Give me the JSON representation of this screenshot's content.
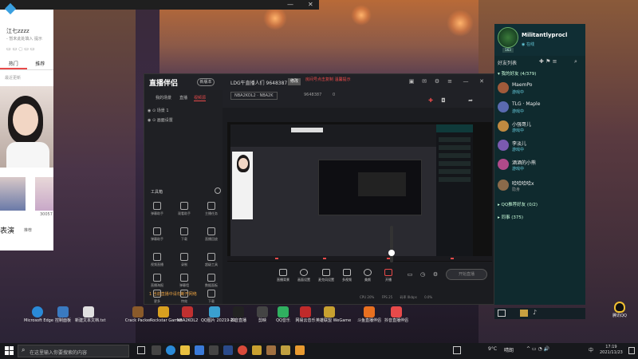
{
  "top_left_window": {
    "user": "江七zzzz",
    "subtitle": "- 暂未此处填入 提示",
    "tabs": [
      "热门",
      "推荐"
    ],
    "list_label": "最近更新",
    "side_text_1": "表演",
    "side_text_2": "推荐",
    "side_count": "30057"
  },
  "main_window": {
    "logo": "直播伴侣",
    "version": "新版本",
    "room_title": "LDG午直播人们 9648387",
    "edit": "修改",
    "warning": "房间号点击复制 温馨提示",
    "game_tag": "NBA2KOL2 · NBA2K",
    "room_id": "9648387",
    "fans": "0",
    "left_tabs": [
      "我的场景",
      "直播",
      "视频源"
    ],
    "scenes": [
      "场景 1",
      "画面设置"
    ],
    "tools_label": "工具箱",
    "tools": [
      "弹幕助手",
      "观看助手",
      "主播任务",
      "弹幕助手",
      "下载",
      "直播回放",
      "视频直播",
      "录制",
      "超级工具",
      "直播海报",
      "弹幕墙",
      "数据面板",
      "更多",
      "特效",
      "下载"
    ],
    "status_line": "1 当前直播中请勿断开网络",
    "bottom_buttons": [
      "直播背景",
      "画面设置",
      "麦克风设置",
      "多视频",
      "美颜",
      "开播"
    ],
    "live_button": "开始直播",
    "footer_stats": [
      "CPU 20%",
      "FPS 25",
      "码率 0kbps",
      "0.0%"
    ]
  },
  "qq_panel": {
    "nickname": "Militantlyprocl",
    "status": "在线",
    "level": "163",
    "friends_heading": "好友列表",
    "groups": [
      "我的好友 (4/379)",
      "QQ推荐好友 (0/2)",
      "同事 (375)"
    ],
    "contacts": [
      {
        "name": "MaemPo",
        "status": "游戏中",
        "color": "#a05a3a"
      },
      {
        "name": "TLG · Maple",
        "status": "游戏中",
        "color": "#5a6ab0"
      },
      {
        "name": "小强哥儿",
        "status": "游戏中",
        "color": "#c08a40"
      },
      {
        "name": "李淡儿",
        "status": "游戏中",
        "color": "#7a5ab0"
      },
      {
        "name": "酒酒的小熊",
        "status": "游戏中",
        "color": "#b04a8a"
      },
      {
        "name": "哈哈哈哈x",
        "status": "隐身",
        "color": "#8a6a4a"
      }
    ]
  },
  "desktop_icons": [
    {
      "label": "Microsoft Edge",
      "color": "#2a8ad8"
    },
    {
      "label": "控制面板",
      "color": "#3a7ac0"
    },
    {
      "label": "新建文本文档.txt",
      "color": "#e0e0e0"
    },
    {
      "label": "Crack Packer",
      "color": "#8a5a2a"
    },
    {
      "label": "Rockstar Games",
      "color": "#d8a020"
    },
    {
      "label": "NBA2KOL2",
      "color": "#c03030"
    },
    {
      "label": "QQ图片 20219-21",
      "color": "#3aa0d0"
    },
    {
      "label": "抖音直播",
      "color": "#222"
    },
    {
      "label": "剪映",
      "color": "#444"
    },
    {
      "label": "QQ音乐",
      "color": "#30b060"
    },
    {
      "label": "网易云音乐",
      "color": "#c02a2a"
    },
    {
      "label": "英雄联盟 WeGame",
      "color": "#c8a030"
    },
    {
      "label": "斗鱼直播伴侣",
      "color": "#e87020"
    },
    {
      "label": "抖音直播伴侣",
      "color": "#e84a4a"
    }
  ],
  "recycle_label": "腾讯QQ",
  "taskbar": {
    "search_placeholder": "在这里输入你要搜索的内容",
    "weather": "9°C",
    "weather_desc": "晴朗",
    "ime": "中",
    "time": "17:19",
    "date": "2021/11/23"
  },
  "colors": {
    "accent_red": "#e84a4a",
    "qq_panel_bg": "#0f2a2e",
    "taskbar_bg": "#17181c"
  }
}
